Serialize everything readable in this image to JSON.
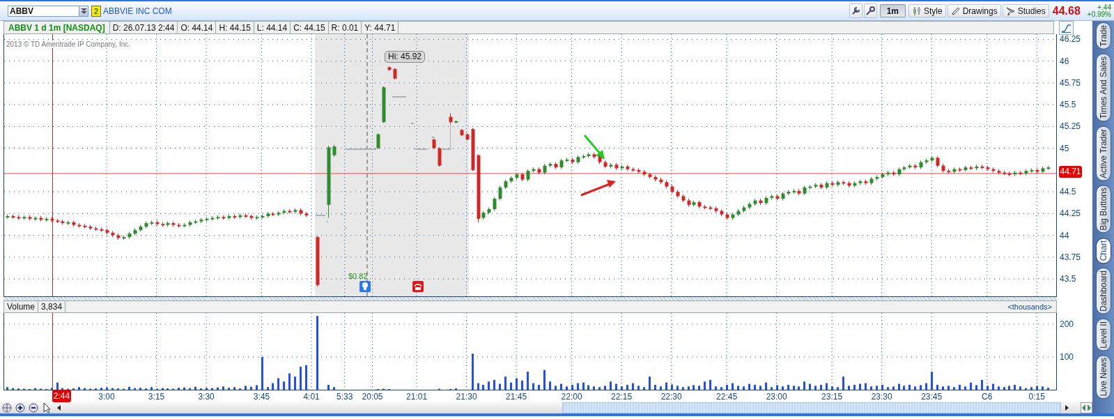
{
  "toolbar": {
    "symbol": "ABBV",
    "badge": "2",
    "company": "ABBVIE INC COM",
    "buttons": [
      {
        "kind": "interval",
        "label": "1m"
      },
      {
        "kind": "style",
        "label": "Style"
      },
      {
        "kind": "drawings",
        "label": "Drawings"
      },
      {
        "kind": "studies",
        "label": "Studies"
      }
    ],
    "last_price": "44.68",
    "change": "+.44",
    "change_percent": "+0.99%"
  },
  "info_bar": {
    "title": "ABBV 1 d 1m [NASDAQ]",
    "fields": [
      "D: 26.07.13 2:44",
      "O: 44.14",
      "H: 44.15",
      "L: 44.14",
      "C: 44.15",
      "R: 0.01",
      "Y: 44.71"
    ]
  },
  "price_chart": {
    "copyright": "2013 © TD Ameritrade IP Company, Inc.",
    "current_price": "44.71",
    "high_label": "Hi: 45.92",
    "dividend_label": "$0.82",
    "chart_data": {
      "type": "candlestick",
      "ylim": [
        43.3,
        46.31
      ],
      "grid": true,
      "ref_lines": [
        {
          "axis": "y",
          "value": 44.71
        }
      ],
      "yticks": [
        {
          "value": 46.25,
          "label": "46.25"
        },
        {
          "value": 46,
          "label": "46"
        },
        {
          "value": 45.75,
          "label": "45.75"
        },
        {
          "value": 45.5,
          "label": "45.5"
        },
        {
          "value": 45.25,
          "label": "45.25"
        },
        {
          "value": 45,
          "label": "45"
        },
        {
          "value": 44.5,
          "label": "44.5"
        },
        {
          "value": 44.25,
          "label": "44.25"
        },
        {
          "value": 44,
          "label": "44"
        },
        {
          "value": 43.75,
          "label": "43.75"
        },
        {
          "value": 43.5,
          "label": "43.5"
        }
      ],
      "categories": [
        null,
        null,
        null,
        null,
        null,
        null,
        null,
        null,
        null,
        null,
        null,
        null,
        null,
        null,
        null,
        null,
        null,
        null,
        null,
        null,
        null,
        null,
        null,
        null,
        null,
        null,
        null,
        null,
        null,
        null,
        null,
        null,
        null,
        null,
        null,
        null,
        null,
        null,
        null,
        null,
        null,
        null,
        null,
        null,
        null,
        null,
        null,
        null,
        null,
        null,
        null,
        null,
        null,
        null,
        null,
        null,
        null,
        null,
        null,
        null,
        null,
        null,
        null,
        null,
        null,
        null,
        null,
        null,
        null,
        null,
        null,
        null,
        null,
        null,
        null,
        null,
        null,
        null,
        null,
        null,
        null,
        null,
        null,
        null,
        null,
        null,
        null,
        null,
        null,
        null,
        null,
        null,
        null,
        null,
        null,
        null,
        null,
        null,
        null,
        null,
        null,
        null,
        null,
        null,
        null,
        null,
        null,
        null,
        null,
        null,
        null,
        null,
        null,
        null,
        null,
        null,
        null,
        null,
        null,
        null,
        null,
        null,
        null,
        null,
        null,
        null,
        null,
        null,
        null,
        null,
        null,
        null,
        null,
        null,
        null,
        null,
        null,
        null,
        null,
        null,
        null,
        null,
        null,
        null,
        null,
        null,
        null,
        null,
        null,
        null,
        null,
        null,
        null,
        null,
        null,
        null,
        null,
        null,
        null,
        null,
        null,
        null,
        null,
        null,
        null,
        null,
        null,
        null,
        null,
        null,
        null,
        null,
        null,
        null,
        null,
        null,
        null,
        null,
        null,
        null,
        null,
        null,
        null,
        null,
        null,
        null,
        null,
        null,
        null,
        null
      ],
      "ohlc": [
        [
          44.21,
          44.24,
          44.19,
          44.22
        ],
        [
          44.22,
          44.24,
          44.19,
          44.21
        ],
        [
          44.21,
          44.23,
          44.18,
          44.2
        ],
        [
          44.2,
          44.23,
          44.18,
          44.21
        ],
        [
          44.21,
          44.23,
          44.17,
          44.19
        ],
        [
          44.19,
          44.22,
          44.17,
          44.2
        ],
        [
          44.2,
          44.22,
          44.16,
          44.18
        ],
        [
          44.18,
          44.21,
          44.16,
          44.19
        ],
        [
          44.19,
          44.21,
          44.15,
          44.17
        ],
        [
          44.17,
          44.19,
          44.14,
          44.16
        ],
        [
          44.16,
          44.18,
          44.12,
          44.14
        ],
        [
          44.14,
          44.17,
          44.12,
          44.15
        ],
        [
          44.15,
          44.17,
          44.1,
          44.12
        ],
        [
          44.12,
          44.14,
          44.09,
          44.11
        ],
        [
          44.11,
          44.13,
          44.08,
          44.1
        ],
        [
          44.1,
          44.12,
          44.06,
          44.08
        ],
        [
          44.08,
          44.1,
          44.05,
          44.07
        ],
        [
          44.07,
          44.09,
          44.04,
          44.06
        ],
        [
          44.06,
          44.08,
          44.01,
          44.03
        ],
        [
          44.03,
          44.05,
          43.98,
          44.0
        ],
        [
          44.0,
          44.02,
          43.95,
          43.97
        ],
        [
          43.97,
          44.0,
          43.95,
          43.98
        ],
        [
          43.98,
          44.04,
          43.96,
          44.02
        ],
        [
          44.02,
          44.08,
          44.0,
          44.06
        ],
        [
          44.06,
          44.12,
          44.04,
          44.1
        ],
        [
          44.1,
          44.16,
          44.08,
          44.14
        ],
        [
          44.14,
          44.17,
          44.12,
          44.15
        ],
        [
          44.15,
          44.17,
          44.11,
          44.13
        ],
        [
          44.13,
          44.15,
          44.1,
          44.12
        ],
        [
          44.12,
          44.16,
          44.1,
          44.14
        ],
        [
          44.14,
          44.16,
          44.1,
          44.12
        ],
        [
          44.12,
          44.14,
          44.09,
          44.11
        ],
        [
          44.11,
          44.14,
          44.09,
          44.12
        ],
        [
          44.12,
          44.17,
          44.1,
          44.15
        ],
        [
          44.15,
          44.18,
          44.13,
          44.16
        ],
        [
          44.16,
          44.2,
          44.14,
          44.18
        ],
        [
          44.18,
          44.21,
          44.16,
          44.19
        ],
        [
          44.19,
          44.22,
          44.17,
          44.2
        ],
        [
          44.2,
          44.23,
          44.18,
          44.21
        ],
        [
          44.21,
          44.23,
          44.18,
          44.2
        ],
        [
          44.2,
          44.24,
          44.18,
          44.22
        ],
        [
          44.22,
          44.24,
          44.19,
          44.21
        ],
        [
          44.21,
          44.25,
          44.19,
          44.23
        ],
        [
          44.23,
          44.25,
          44.2,
          44.22
        ],
        [
          44.22,
          44.24,
          44.18,
          44.2
        ],
        [
          44.2,
          44.23,
          44.18,
          44.21
        ],
        [
          44.21,
          44.24,
          44.19,
          44.22
        ],
        [
          44.22,
          44.27,
          44.2,
          44.25
        ],
        [
          44.25,
          44.27,
          44.22,
          44.24
        ],
        [
          44.24,
          44.28,
          44.22,
          44.26
        ],
        [
          44.26,
          44.3,
          44.24,
          44.28
        ],
        [
          44.28,
          44.3,
          44.25,
          44.27
        ],
        [
          44.27,
          44.31,
          44.25,
          44.29
        ],
        [
          44.29,
          44.31,
          44.23,
          44.25
        ],
        [
          44.25,
          44.27,
          44.21,
          44.23
        ],
        null,
        [
          43.98,
          43.99,
          43.41,
          43.43
        ],
        null,
        [
          44.35,
          45.03,
          44.2,
          45.01
        ],
        [
          44.92,
          45.04,
          44.9,
          45.02
        ],
        null,
        null,
        null,
        null,
        null,
        null,
        null,
        [
          45.0,
          45.17,
          44.99,
          45.16
        ],
        [
          45.3,
          45.71,
          45.29,
          45.7
        ],
        [
          45.93,
          45.94,
          45.89,
          45.9
        ],
        [
          45.91,
          45.92,
          45.79,
          45.8
        ],
        null,
        null,
        null,
        null,
        null,
        null,
        [
          45.1,
          45.11,
          44.99,
          45.0
        ],
        [
          45.0,
          45.01,
          44.79,
          44.8
        ],
        null,
        [
          45.36,
          45.4,
          45.28,
          45.3
        ],
        [
          45.3,
          45.32,
          45.29,
          45.31
        ],
        [
          45.21,
          45.22,
          45.14,
          45.15
        ],
        [
          45.16,
          45.17,
          45.09,
          45.1
        ],
        [
          45.22,
          45.23,
          44.74,
          44.75
        ],
        [
          44.92,
          44.93,
          44.15,
          44.19
        ],
        [
          44.2,
          44.28,
          44.18,
          44.26
        ],
        [
          44.26,
          44.32,
          44.24,
          44.3
        ],
        [
          44.3,
          44.44,
          44.28,
          44.42
        ],
        [
          44.42,
          44.57,
          44.4,
          44.55
        ],
        [
          44.55,
          44.64,
          44.53,
          44.62
        ],
        [
          44.62,
          44.68,
          44.6,
          44.66
        ],
        [
          44.66,
          44.72,
          44.64,
          44.7
        ],
        [
          44.7,
          44.72,
          44.62,
          44.64
        ],
        [
          44.64,
          44.76,
          44.62,
          44.74
        ],
        [
          44.74,
          44.78,
          44.72,
          44.76
        ],
        [
          44.76,
          44.78,
          44.7,
          44.72
        ],
        [
          44.72,
          44.82,
          44.7,
          44.8
        ],
        [
          44.8,
          44.84,
          44.78,
          44.82
        ],
        [
          44.82,
          44.84,
          44.76,
          44.78
        ],
        [
          44.78,
          44.88,
          44.76,
          44.86
        ],
        [
          44.86,
          44.89,
          44.84,
          44.87
        ],
        [
          44.87,
          44.89,
          44.82,
          44.84
        ],
        [
          44.84,
          44.92,
          44.82,
          44.9
        ],
        [
          44.9,
          44.93,
          44.88,
          44.91
        ],
        [
          44.91,
          44.95,
          44.89,
          44.93
        ],
        [
          44.93,
          44.95,
          44.88,
          44.9
        ],
        [
          44.9,
          44.92,
          44.82,
          44.84
        ],
        [
          44.84,
          44.86,
          44.77,
          44.79
        ],
        [
          44.79,
          44.83,
          44.77,
          44.81
        ],
        [
          44.81,
          44.83,
          44.75,
          44.77
        ],
        [
          44.77,
          44.81,
          44.75,
          44.79
        ],
        [
          44.79,
          44.81,
          44.74,
          44.76
        ],
        [
          44.76,
          44.78,
          44.73,
          44.75
        ],
        [
          44.75,
          44.77,
          44.71,
          44.73
        ],
        [
          44.73,
          44.75,
          44.68,
          44.7
        ],
        [
          44.7,
          44.72,
          44.65,
          44.67
        ],
        [
          44.67,
          44.69,
          44.62,
          44.64
        ],
        [
          44.64,
          44.66,
          44.59,
          44.61
        ],
        [
          44.61,
          44.63,
          44.54,
          44.56
        ],
        [
          44.56,
          44.58,
          44.48,
          44.5
        ],
        [
          44.5,
          44.52,
          44.43,
          44.45
        ],
        [
          44.45,
          44.47,
          44.38,
          44.4
        ],
        [
          44.4,
          44.42,
          44.33,
          44.35
        ],
        [
          44.35,
          44.4,
          44.33,
          44.38
        ],
        [
          44.38,
          44.4,
          44.31,
          44.33
        ],
        [
          44.33,
          44.35,
          44.3,
          44.32
        ],
        [
          44.32,
          44.34,
          44.29,
          44.31
        ],
        [
          44.31,
          44.33,
          44.26,
          44.28
        ],
        [
          44.28,
          44.3,
          44.22,
          44.24
        ],
        [
          44.24,
          44.26,
          44.18,
          44.2
        ],
        [
          44.2,
          44.26,
          44.18,
          44.24
        ],
        [
          44.24,
          44.3,
          44.22,
          44.28
        ],
        [
          44.28,
          44.34,
          44.26,
          44.32
        ],
        [
          44.32,
          44.38,
          44.3,
          44.36
        ],
        [
          44.36,
          44.42,
          44.34,
          44.4
        ],
        [
          44.4,
          44.42,
          44.35,
          44.37
        ],
        [
          44.37,
          44.45,
          44.35,
          44.43
        ],
        [
          44.43,
          44.47,
          44.41,
          44.45
        ],
        [
          44.45,
          44.47,
          44.4,
          44.42
        ],
        [
          44.42,
          44.5,
          44.4,
          44.48
        ],
        [
          44.48,
          44.52,
          44.46,
          44.5
        ],
        [
          44.5,
          44.53,
          44.48,
          44.51
        ],
        [
          44.51,
          44.53,
          44.46,
          44.48
        ],
        [
          44.48,
          44.57,
          44.46,
          44.55
        ],
        [
          44.55,
          44.58,
          44.53,
          44.56
        ],
        [
          44.56,
          44.6,
          44.54,
          44.58
        ],
        [
          44.58,
          44.6,
          44.53,
          44.55
        ],
        [
          44.55,
          44.62,
          44.53,
          44.6
        ],
        [
          44.6,
          44.62,
          44.56,
          44.58
        ],
        [
          44.58,
          44.63,
          44.56,
          44.61
        ],
        [
          44.61,
          44.63,
          44.58,
          44.6
        ],
        [
          44.6,
          44.62,
          44.55,
          44.57
        ],
        [
          44.57,
          44.62,
          44.55,
          44.6
        ],
        [
          44.6,
          44.64,
          44.58,
          44.62
        ],
        [
          44.62,
          44.64,
          44.58,
          44.6
        ],
        [
          44.6,
          44.67,
          44.58,
          44.65
        ],
        [
          44.65,
          44.69,
          44.63,
          44.67
        ],
        [
          44.67,
          44.72,
          44.65,
          44.7
        ],
        [
          44.7,
          44.74,
          44.68,
          44.72
        ],
        [
          44.72,
          44.74,
          44.68,
          44.7
        ],
        [
          44.7,
          44.78,
          44.68,
          44.76
        ],
        [
          44.76,
          44.8,
          44.74,
          44.78
        ],
        [
          44.78,
          44.82,
          44.76,
          44.8
        ],
        [
          44.8,
          44.82,
          44.76,
          44.78
        ],
        [
          44.78,
          44.86,
          44.76,
          44.84
        ],
        [
          44.84,
          44.88,
          44.82,
          44.86
        ],
        [
          44.86,
          44.91,
          44.84,
          44.89
        ],
        [
          44.89,
          44.91,
          44.78,
          44.8
        ],
        [
          44.8,
          44.82,
          44.72,
          44.74
        ],
        [
          44.74,
          44.76,
          44.71,
          44.73
        ],
        [
          44.73,
          44.78,
          44.71,
          44.76
        ],
        [
          44.76,
          44.78,
          44.73,
          44.75
        ],
        [
          44.75,
          44.8,
          44.73,
          44.78
        ],
        [
          44.78,
          44.8,
          44.75,
          44.77
        ],
        [
          44.77,
          44.81,
          44.75,
          44.79
        ],
        [
          44.79,
          44.81,
          44.76,
          44.78
        ],
        [
          44.78,
          44.8,
          44.74,
          44.76
        ],
        [
          44.76,
          44.78,
          44.72,
          44.74
        ],
        [
          44.74,
          44.76,
          44.7,
          44.72
        ],
        [
          44.72,
          44.74,
          44.69,
          44.71
        ],
        [
          44.71,
          44.73,
          44.68,
          44.7
        ],
        [
          44.7,
          44.74,
          44.68,
          44.72
        ],
        [
          44.72,
          44.74,
          44.69,
          44.71
        ],
        [
          44.71,
          44.76,
          44.69,
          44.74
        ],
        [
          44.74,
          44.77,
          44.72,
          44.75
        ],
        [
          44.75,
          44.77,
          44.71,
          44.73
        ],
        [
          44.73,
          44.79,
          44.71,
          44.77
        ],
        [
          44.77,
          44.8,
          44.75,
          44.78
        ],
        null
      ]
    }
  },
  "volume_chart": {
    "title": "Volume",
    "value": "3,834",
    "units": "<thousands>",
    "chart_data": {
      "type": "bar",
      "ylim": [
        0,
        234
      ],
      "grid": true,
      "yticks": [
        {
          "value": 200,
          "label": "200"
        },
        {
          "value": 100,
          "label": "100"
        }
      ],
      "categories": [
        null,
        null,
        null,
        null,
        null,
        null,
        null,
        null,
        null,
        null,
        null,
        null,
        null,
        null,
        null,
        null,
        null,
        null,
        "3:00",
        null,
        null,
        null,
        null,
        null,
        null,
        null,
        null,
        "3:15",
        null,
        null,
        null,
        null,
        null,
        null,
        null,
        null,
        "3:30",
        null,
        null,
        null,
        null,
        null,
        null,
        null,
        null,
        null,
        "3:45",
        null,
        null,
        null,
        null,
        null,
        null,
        null,
        null,
        "4:01",
        null,
        null,
        null,
        null,
        null,
        "5:33",
        null,
        null,
        null,
        null,
        "20:05",
        null,
        null,
        null,
        null,
        null,
        null,
        null,
        "21:01",
        null,
        null,
        null,
        null,
        null,
        null,
        null,
        null,
        "21:30",
        null,
        null,
        null,
        null,
        null,
        null,
        null,
        null,
        "21:45",
        null,
        null,
        null,
        null,
        null,
        null,
        null,
        null,
        null,
        "22:00",
        null,
        null,
        null,
        null,
        null,
        null,
        null,
        null,
        "22:15",
        null,
        null,
        null,
        null,
        null,
        null,
        null,
        null,
        "22:30",
        null,
        null,
        null,
        null,
        null,
        null,
        null,
        null,
        null,
        "22:45",
        null,
        null,
        null,
        null,
        null,
        null,
        null,
        null,
        "23:00",
        null,
        null,
        null,
        null,
        null,
        null,
        null,
        null,
        null,
        "23:15",
        null,
        null,
        null,
        null,
        null,
        null,
        null,
        null,
        "23:30",
        null,
        null,
        null,
        null,
        null,
        null,
        null,
        null,
        "23:45",
        null,
        null,
        null,
        null,
        null,
        null,
        null,
        null,
        null,
        "C6",
        null,
        null,
        null,
        null,
        null,
        null,
        null,
        null,
        "0:15",
        null,
        null,
        null
      ],
      "values": [
        8,
        5,
        4,
        3,
        2,
        5,
        3,
        2,
        6,
        22,
        5,
        3,
        4,
        8,
        5,
        3,
        4,
        6,
        7,
        5,
        4,
        3,
        9,
        5,
        6,
        4,
        8,
        3,
        5,
        4,
        3,
        6,
        7,
        5,
        9,
        4,
        6,
        5,
        7,
        10,
        6,
        8,
        4,
        12,
        9,
        14,
        100,
        8,
        20,
        35,
        25,
        50,
        40,
        70,
        75,
        null,
        225,
        null,
        15,
        8,
        null,
        null,
        null,
        null,
        null,
        null,
        null,
        2,
        3,
        2,
        null,
        null,
        null,
        null,
        null,
        null,
        null,
        null,
        3,
        null,
        2,
        4,
        null,
        null,
        110,
        20,
        15,
        25,
        30,
        18,
        40,
        22,
        35,
        28,
        55,
        20,
        15,
        60,
        25,
        12,
        18,
        10,
        15,
        20,
        22,
        14,
        10,
        8,
        12,
        25,
        18,
        10,
        15,
        20,
        12,
        8,
        40,
        15,
        10,
        22,
        16,
        12,
        8,
        10,
        14,
        12,
        25,
        30,
        10,
        8,
        15,
        20,
        12,
        10,
        18,
        15,
        12,
        22,
        8,
        14,
        10,
        15,
        12,
        10,
        25,
        18,
        12,
        15,
        20,
        10,
        8,
        40,
        12,
        15,
        18,
        20,
        10,
        12,
        15,
        8,
        10,
        18,
        12,
        15,
        10,
        14,
        20,
        55,
        15,
        10,
        12,
        8,
        15,
        10,
        22,
        14,
        30,
        12,
        18,
        10,
        8,
        12,
        15,
        10,
        5,
        8,
        12,
        10,
        6,
        null
      ]
    }
  },
  "time_axis": {
    "cursor_label": "2:44"
  },
  "side_tabs": [
    {
      "label": "Trade",
      "selected": false
    },
    {
      "label": "Times And Sales",
      "selected": false
    },
    {
      "label": "Active Trader",
      "selected": false
    },
    {
      "label": "Big Buttons",
      "selected": false
    },
    {
      "label": "Chart",
      "selected": true
    },
    {
      "label": "Dashboard",
      "selected": false
    },
    {
      "label": "Level II",
      "selected": false
    },
    {
      "label": "Live News",
      "selected": false
    }
  ]
}
